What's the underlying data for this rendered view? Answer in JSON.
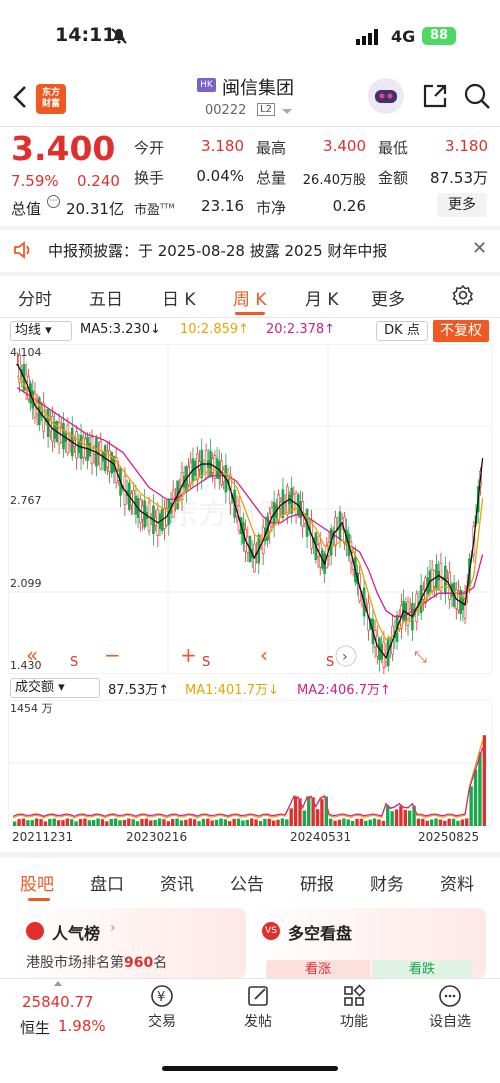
{
  "status": {
    "time": "14:11",
    "network": "4G",
    "battery": "88"
  },
  "nav": {
    "market_badge": "HK",
    "stock_name": "闽信集团",
    "stock_code": "00222",
    "level": "L2",
    "logo": "东方\n财富"
  },
  "quote": {
    "price": "3.400",
    "change_pct": "7.59%",
    "change": "0.240",
    "market_cap_label": "总值",
    "market_cap": "20.31亿",
    "open_label": "今开",
    "open": "3.180",
    "high_label": "最高",
    "high": "3.400",
    "low_label": "最低",
    "low": "3.180",
    "turnover_label": "换手",
    "turnover": "0.04%",
    "volume_label": "总量",
    "volume": "26.40万股",
    "amount_label": "金额",
    "amount": "87.53万",
    "pe_label": "市盈",
    "pe_sup": "TTM",
    "pe": "23.16",
    "pb_label": "市净",
    "pb": "0.26",
    "more": "更多"
  },
  "notice": {
    "text": "中报预披露：于 2025-08-28 披露 2025 财年中报"
  },
  "tabs": [
    "分时",
    "五日",
    "日 K",
    "周 K",
    "月 K",
    "更多"
  ],
  "active_tab": "周 K",
  "ma": {
    "select": "均线",
    "ma5": "MA5:3.230↓",
    "ma10": "10:2.859↑",
    "ma20": "20:2.378↑",
    "dk": "DK 点",
    "fq": "不复权"
  },
  "kchart": {
    "y_top": "4.104",
    "y_mid1": "2.767",
    "y_mid2": "2.099",
    "y_bot": "1.430",
    "watermark": "东方财富",
    "s_labels": [
      "S",
      "S",
      "S"
    ]
  },
  "volume": {
    "select": "成交额",
    "value": "87.53万↑",
    "ma1": "MA1:401.7万↓",
    "ma2": "MA2:406.7万↑",
    "y_max": "1454 万"
  },
  "dates": [
    "20211231",
    "20230216",
    "20240531",
    "20250825"
  ],
  "subtabs": [
    "股吧",
    "盘口",
    "资讯",
    "公告",
    "研报",
    "财务",
    "资料"
  ],
  "cards": {
    "popularity_title": "人气榜",
    "popularity_text": "港股市场排名第",
    "popularity_rank": "960",
    "popularity_unit": "名",
    "bull_bear_title": "多空看盘",
    "bull": "看涨",
    "bear": "看跌"
  },
  "bottom": {
    "index_value": "25840.77",
    "index_name": "恒生",
    "index_change": "1.98%",
    "nav": [
      "交易",
      "发帖",
      "功能",
      "设自选"
    ]
  },
  "colors": {
    "up": "#e0302e",
    "down": "#1aa64a",
    "accent": "#f05a22",
    "ma5": "#111111",
    "ma10": "#e9a400",
    "ma20": "#d0208a"
  },
  "chart_data": {
    "type": "candlestick",
    "ylim": [
      1.43,
      4.104
    ],
    "ma5": [
      4.0,
      3.85,
      3.65,
      3.55,
      3.45,
      3.4,
      3.35,
      3.3,
      3.28,
      3.25,
      3.2,
      3.15,
      2.95,
      2.85,
      2.75,
      2.7,
      2.65,
      2.7,
      2.85,
      3.0,
      3.1,
      3.15,
      3.15,
      3.1,
      3.0,
      2.75,
      2.5,
      2.35,
      2.5,
      2.7,
      2.8,
      2.85,
      2.8,
      2.65,
      2.45,
      2.3,
      2.55,
      2.65,
      2.4,
      2.1,
      1.85,
      1.6,
      1.5,
      1.7,
      1.9,
      1.85,
      2.0,
      2.15,
      2.2,
      2.15,
      2.0,
      1.95,
      2.5,
      3.2
    ],
    "ma10": [
      3.9,
      3.8,
      3.7,
      3.6,
      3.5,
      3.45,
      3.4,
      3.35,
      3.3,
      3.28,
      3.25,
      3.2,
      3.1,
      3.0,
      2.9,
      2.85,
      2.8,
      2.75,
      2.8,
      2.9,
      3.0,
      3.05,
      3.1,
      3.1,
      3.05,
      2.95,
      2.75,
      2.55,
      2.5,
      2.6,
      2.7,
      2.75,
      2.78,
      2.7,
      2.6,
      2.45,
      2.45,
      2.5,
      2.45,
      2.3,
      2.05,
      1.8,
      1.65,
      1.7,
      1.8,
      1.85,
      1.95,
      2.05,
      2.1,
      2.1,
      2.05,
      2.0,
      2.2,
      2.86
    ],
    "ma20": [
      3.8,
      3.75,
      3.7,
      3.65,
      3.6,
      3.55,
      3.5,
      3.45,
      3.4,
      3.38,
      3.35,
      3.3,
      3.25,
      3.15,
      3.05,
      2.95,
      2.9,
      2.85,
      2.85,
      2.9,
      2.95,
      3.0,
      3.05,
      3.05,
      3.05,
      3.0,
      2.9,
      2.8,
      2.7,
      2.65,
      2.65,
      2.7,
      2.72,
      2.7,
      2.65,
      2.6,
      2.55,
      2.5,
      2.45,
      2.4,
      2.25,
      2.05,
      1.9,
      1.85,
      1.85,
      1.9,
      1.95,
      2.0,
      2.05,
      2.05,
      2.05,
      2.05,
      2.1,
      2.38
    ],
    "volume_ylim": [
      0,
      1454
    ]
  }
}
